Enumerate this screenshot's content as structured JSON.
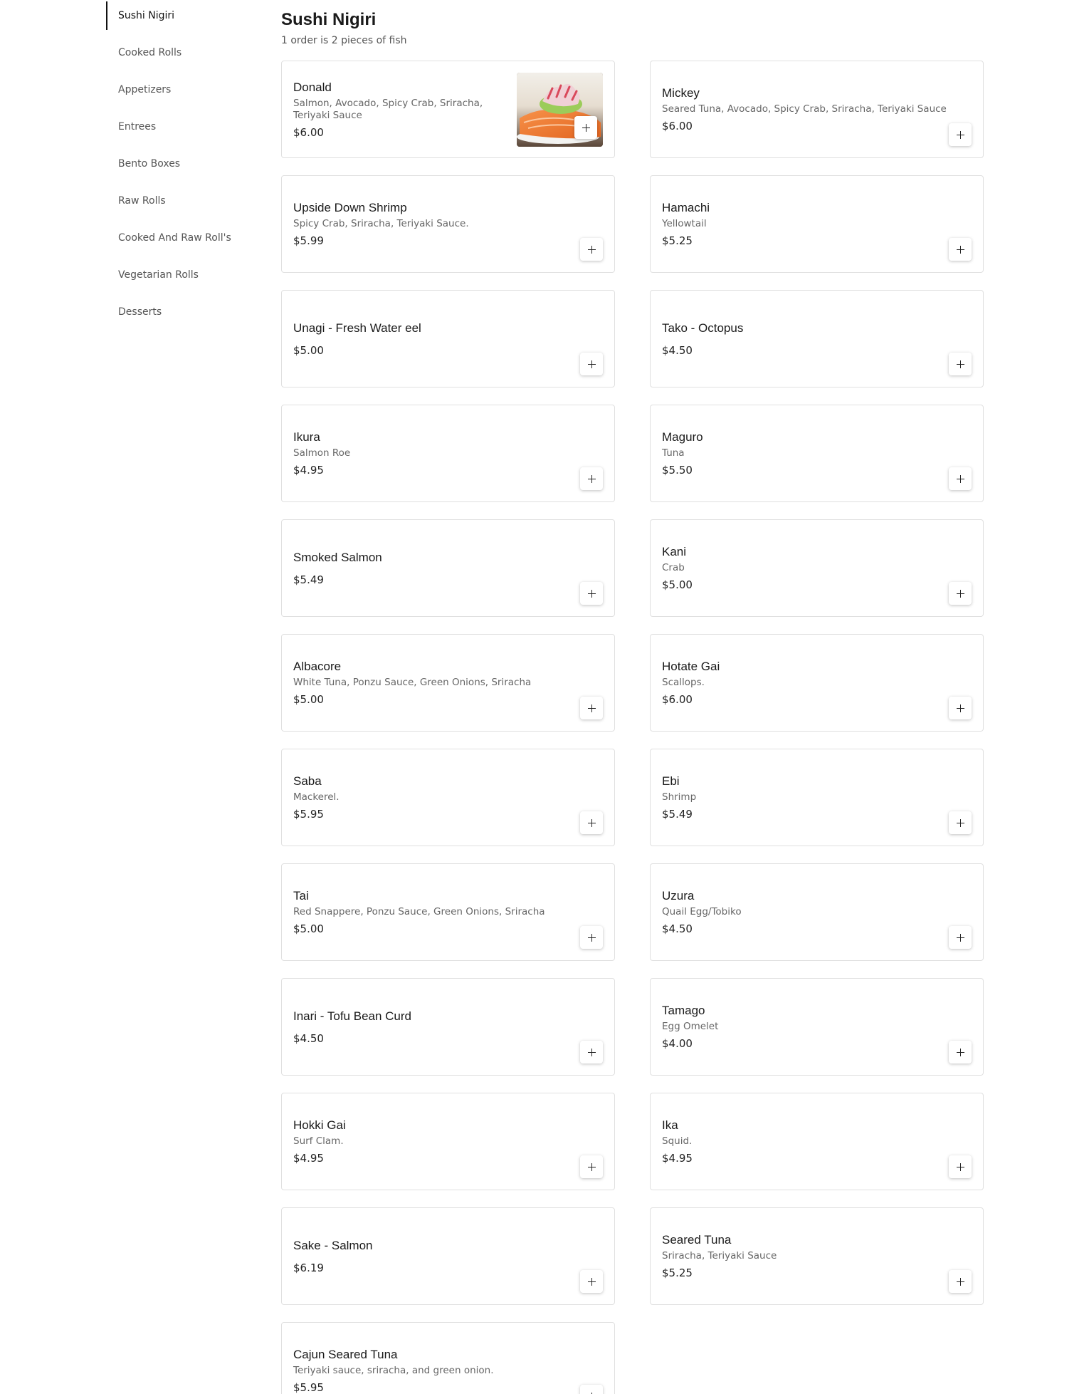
{
  "sidebar": {
    "items": [
      {
        "label": "Sushi Nigiri",
        "active": true
      },
      {
        "label": "Cooked Rolls"
      },
      {
        "label": "Appetizers"
      },
      {
        "label": "Entrees"
      },
      {
        "label": "Bento Boxes"
      },
      {
        "label": "Raw Rolls"
      },
      {
        "label": "Cooked And Raw Roll's"
      },
      {
        "label": "Vegetarian Rolls"
      },
      {
        "label": "Desserts"
      }
    ]
  },
  "section": {
    "title": "Sushi Nigiri",
    "subtitle": "1 order is 2 pieces of fish"
  },
  "items": [
    {
      "name": "Donald",
      "desc": "Salmon, Avocado, Spicy Crab, Sriracha, Teriyaki Sauce",
      "price": "$6.00",
      "image": true
    },
    {
      "name": "Mickey",
      "desc": "Seared Tuna, Avocado, Spicy Crab, Sriracha, Teriyaki Sauce",
      "price": "$6.00"
    },
    {
      "name": "Upside Down Shrimp",
      "desc": "Spicy Crab, Sriracha, Teriyaki Sauce.",
      "price": "$5.99"
    },
    {
      "name": "Hamachi",
      "desc": "Yellowtail",
      "price": "$5.25"
    },
    {
      "name": "Unagi - Fresh Water eel",
      "desc": "",
      "price": "$5.00"
    },
    {
      "name": "Tako - Octopus",
      "desc": "",
      "price": "$4.50"
    },
    {
      "name": "Ikura",
      "desc": "Salmon Roe",
      "price": "$4.95"
    },
    {
      "name": "Maguro",
      "desc": "Tuna",
      "price": "$5.50"
    },
    {
      "name": "Smoked Salmon",
      "desc": "",
      "price": "$5.49"
    },
    {
      "name": "Kani",
      "desc": "Crab",
      "price": "$5.00"
    },
    {
      "name": "Albacore",
      "desc": "White Tuna, Ponzu Sauce, Green Onions, Sriracha",
      "price": "$5.00"
    },
    {
      "name": "Hotate Gai",
      "desc": "Scallops.",
      "price": "$6.00"
    },
    {
      "name": "Saba",
      "desc": "Mackerel.",
      "price": "$5.95"
    },
    {
      "name": "Ebi",
      "desc": "Shrimp",
      "price": "$5.49"
    },
    {
      "name": "Tai",
      "desc": "Red Snappere, Ponzu Sauce, Green Onions, Sriracha",
      "price": "$5.00"
    },
    {
      "name": "Uzura",
      "desc": "Quail Egg/Tobiko",
      "price": "$4.50"
    },
    {
      "name": "Inari - Tofu Bean Curd",
      "desc": "",
      "price": "$4.50"
    },
    {
      "name": "Tamago",
      "desc": "Egg Omelet",
      "price": "$4.00"
    },
    {
      "name": "Hokki Gai",
      "desc": "Surf Clam.",
      "price": "$4.95"
    },
    {
      "name": "Ika",
      "desc": "Squid.",
      "price": "$4.95"
    },
    {
      "name": "Sake - Salmon",
      "desc": "",
      "price": "$6.19"
    },
    {
      "name": "Seared Tuna",
      "desc": "Sriracha, Teriyaki Sauce",
      "price": "$5.25"
    },
    {
      "name": "Cajun Seared Tuna",
      "desc": "Teriyaki sauce, sriracha, and green onion.",
      "price": "$5.95"
    }
  ]
}
